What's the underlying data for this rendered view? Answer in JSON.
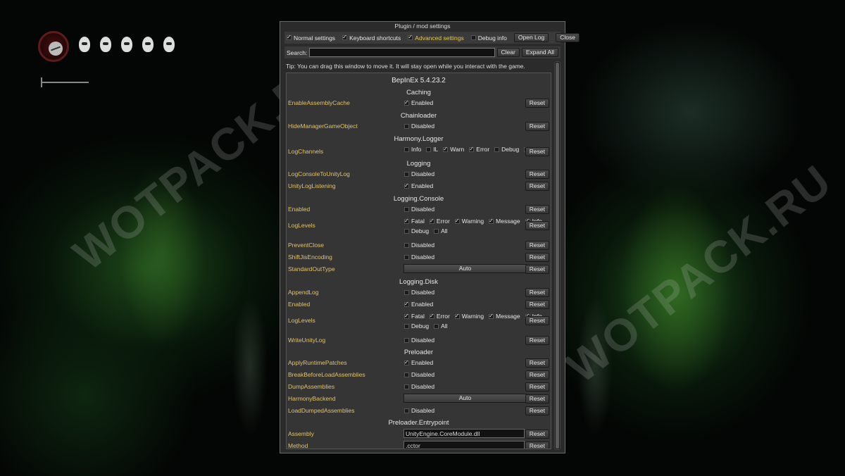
{
  "watermark": "WOTPACK.RU",
  "window": {
    "title": "Plugin / mod settings",
    "toolbar": {
      "normal": "Normal settings",
      "keyboard": "Keyboard shortcuts",
      "advanced": "Advanced settings",
      "debug": "Debug info",
      "open_log": "Open Log",
      "close": "Close"
    },
    "search": {
      "label": "Search:",
      "value": "",
      "clear": "Clear",
      "expand": "Expand All"
    },
    "tip": "Tip: You can drag this window to move it. It will stay open while you interact with the game.",
    "plugin": "BepInEx 5.4.23.2",
    "reset": "Reset",
    "sections": {
      "caching": "Caching",
      "chainloader": "Chainloader",
      "harmony": "Harmony.Logger",
      "logging": "Logging",
      "console": "Logging.Console",
      "disk": "Logging.Disk",
      "preloader": "Preloader",
      "entrypoint": "Preloader.Entrypoint"
    },
    "labels": {
      "enabled": "Enabled",
      "disabled": "Disabled",
      "auto": "Auto",
      "info": "Info",
      "il": "IL",
      "warn": "Warn",
      "error": "Error",
      "debug": "Debug",
      "all": "All",
      "fatal": "Fatal",
      "warning": "Warning",
      "message": "Message"
    },
    "settings": {
      "enable_assembly_cache": "EnableAssemblyCache",
      "hide_manager": "HideManagerGameObject",
      "log_channels": "LogChannels",
      "log_console_to_unity": "LogConsoleToUnityLog",
      "unity_log_listening": "UnityLogListening",
      "console_enabled": "Enabled",
      "console_log_levels": "LogLevels",
      "prevent_close": "PreventClose",
      "shift_jis": "ShiftJisEncoding",
      "std_out_type": "StandardOutType",
      "append_log": "AppendLog",
      "disk_enabled": "Enabled",
      "disk_log_levels": "LogLevels",
      "write_unity_log": "WriteUnityLog",
      "apply_runtime": "ApplyRuntimePatches",
      "break_before": "BreakBeforeLoadAssemblies",
      "dump_assemblies": "DumpAssemblies",
      "harmony_backend": "HarmonyBackend",
      "load_dumped": "LoadDumpedAssemblies",
      "assembly": "Assembly",
      "method": "Method"
    },
    "values": {
      "assembly": "UnityEngine.CoreModule.dll",
      "method": ".cctor"
    }
  }
}
